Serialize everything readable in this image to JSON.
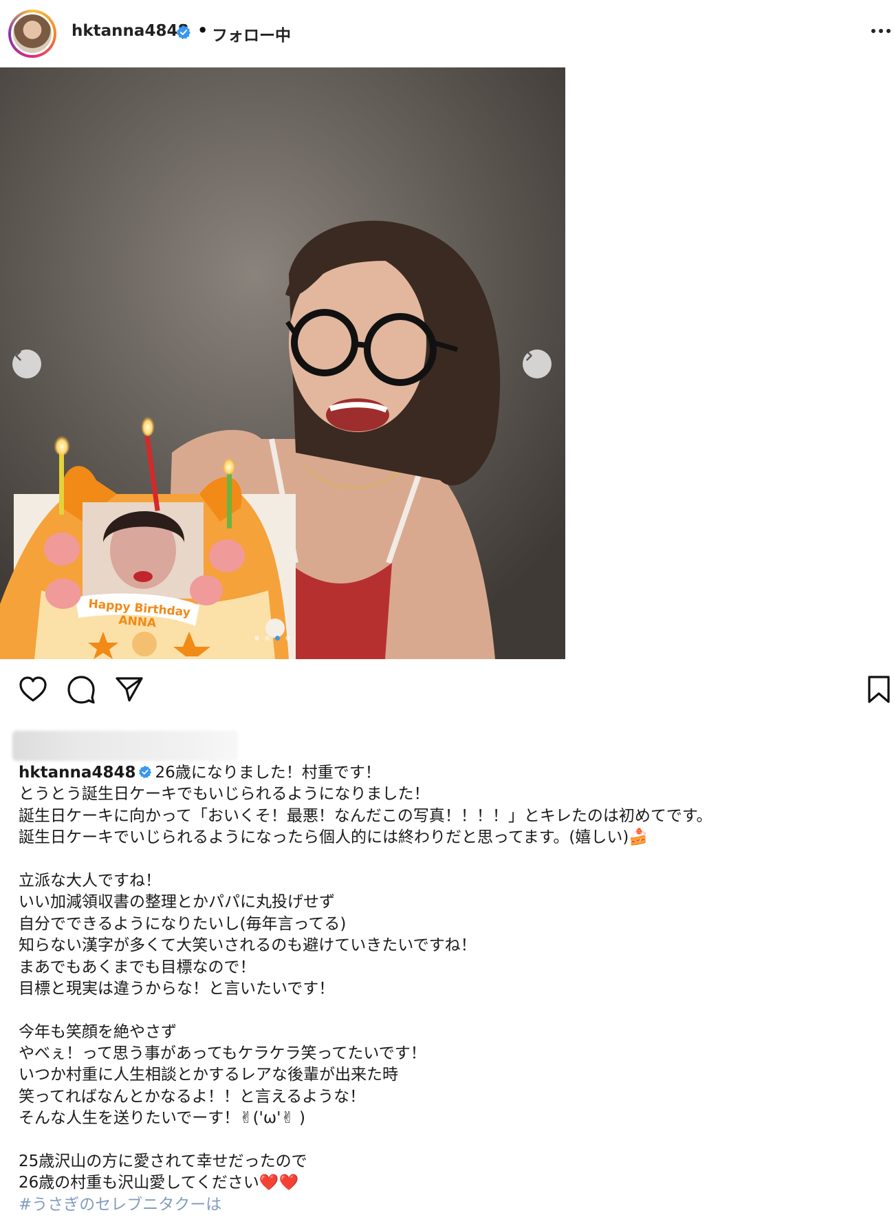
{
  "header": {
    "username": "hktanna4848",
    "separator": "•",
    "follow_status": "フォロー中",
    "icons": {
      "avatar": "profile-avatar",
      "verified": "verified-badge-icon",
      "more": "more-options-icon"
    },
    "colors": {
      "verified": "#3897f0"
    }
  },
  "photo": {
    "cake_text_line1": "Happy Birthday",
    "cake_text_line2": "ANNA",
    "carousel_dots": 4,
    "active_dot": 2,
    "icons": {
      "prev": "chevron-left-icon",
      "next": "chevron-right-icon"
    }
  },
  "actions": {
    "icons": [
      "heart-icon",
      "comment-icon",
      "share-icon",
      "bookmark-icon"
    ]
  },
  "caption": {
    "username": "hktanna4848",
    "first_line": "26歳になりました！村重です！",
    "lines": [
      "とうとう誕生日ケーキでもいじられるようになりました！",
      "誕生日ケーキに向かって「おいくそ！最悪！なんだこの写真！！！！」とキレたのは初めてです。",
      "誕生日ケーキでいじられるようになったら個人的には終わりだと思ってます。(嬉しい)🍰",
      "",
      "立派な大人ですね！",
      "いい加減領収書の整理とかパパに丸投げせず",
      "自分でできるようになりたいし(毎年言ってる)",
      "知らない漢字が多くて大笑いされるのも避けていきたいですね！",
      "まあでもあくまでも目標なので！",
      "目標と現実は違うからな！と言いたいです！",
      "",
      "今年も笑顔を絶やさず",
      "やべぇ！って思う事があってもケラケラ笑ってたいです！",
      "いつか村重に人生相談とかするレアな後輩が出来た時",
      "笑ってればなんとかなるよ！！と言えるような！",
      "そんな人生を送りたいでーす！✌('ω'✌ )",
      "",
      "25歳沢山の方に愛されて幸せだったので",
      "26歳の村重も沢山愛してください❤️❤️"
    ],
    "hashtag_partial": "#うさぎのセレブニタクーは"
  }
}
